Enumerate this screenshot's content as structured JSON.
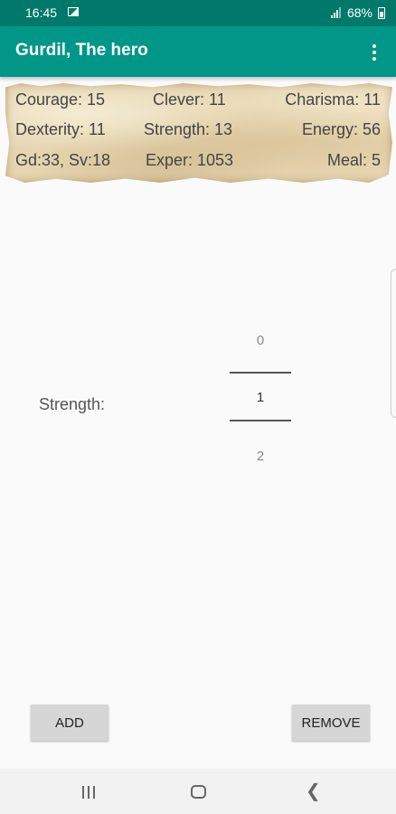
{
  "status_bar": {
    "time": "16:45",
    "battery": "68%"
  },
  "app_bar": {
    "title": "Gurdil, The hero",
    "overflow_icon": "more-vert-icon"
  },
  "stats": {
    "courage": "Courage: 15",
    "clever": "Clever: 11",
    "charisma": "Charisma: 11",
    "dexterity": "Dexterity: 11",
    "strength": "Strength: 13",
    "energy": "Energy: 56",
    "gold_silver": "Gd:33, Sv:18",
    "experience": "Exper: 1053",
    "meal": "Meal: 5"
  },
  "picker": {
    "label": "Strength:",
    "previous": "0",
    "selected": "1",
    "next": "2"
  },
  "buttons": {
    "add": "ADD",
    "remove": "REMOVE"
  },
  "colors": {
    "status_bar": "#00796b",
    "app_bar": "#009688",
    "parchment": "#e6d5b0",
    "button": "#d6d6d6"
  }
}
